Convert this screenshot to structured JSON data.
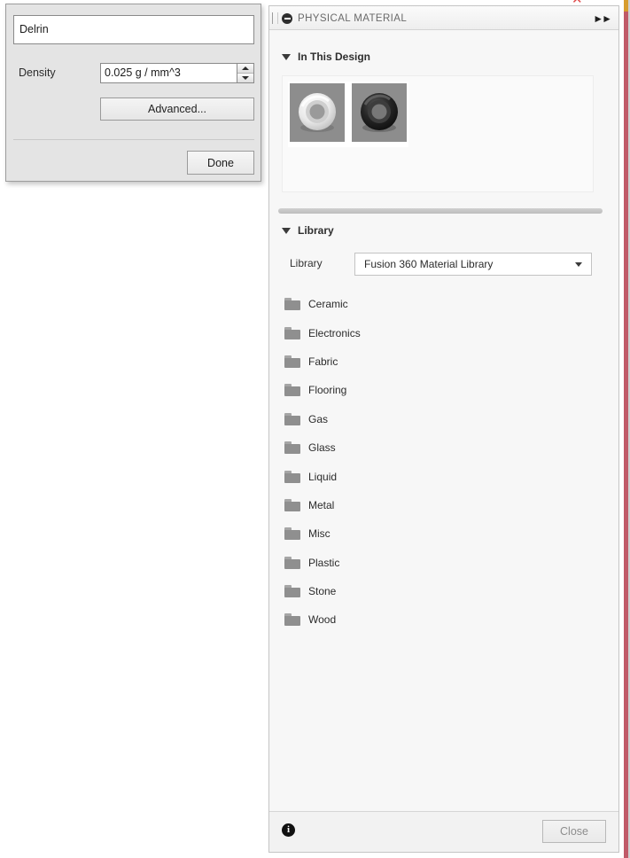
{
  "edit_dialog": {
    "material_name": "Delrin",
    "density_label": "Density",
    "density_value": "0.025 g / mm^3",
    "advanced_label": "Advanced...",
    "done_label": "Done",
    "spinner_up_icon": "triangle-up-icon",
    "spinner_down_icon": "triangle-down-icon"
  },
  "panel": {
    "title": "PHYSICAL MATERIAL",
    "collapse_icon": "minus-circle-icon",
    "grip_icon": "drag-grip-icon",
    "expand_icon": "double-chevron-right-icon",
    "in_this_design": {
      "label": "In This Design",
      "expanded_icon": "triangle-down-icon",
      "swatches": [
        {
          "name": "white-torus-material-swatch"
        },
        {
          "name": "black-torus-material-swatch"
        }
      ]
    },
    "library": {
      "label": "Library",
      "expanded_icon": "triangle-down-icon",
      "field_label": "Library",
      "selected": "Fusion 360 Material Library",
      "dropdown_icon": "chevron-down-icon",
      "folders": [
        "Ceramic",
        "Electronics",
        "Fabric",
        "Flooring",
        "Gas",
        "Glass",
        "Liquid",
        "Metal",
        "Misc",
        "Plastic",
        "Stone",
        "Wood"
      ]
    },
    "footer": {
      "info_icon": "info-circle-icon",
      "close_label": "Close"
    }
  },
  "decor": {
    "close_x_fragment": "✕"
  },
  "colors": {
    "dialog_bg": "#e4e4e4",
    "panel_bg": "#f7f7f7",
    "folder_icon": "#8f8f8f",
    "edge_gold": "#d79d2e",
    "edge_red": "#c05a68",
    "x_red": "#e04a4a"
  }
}
